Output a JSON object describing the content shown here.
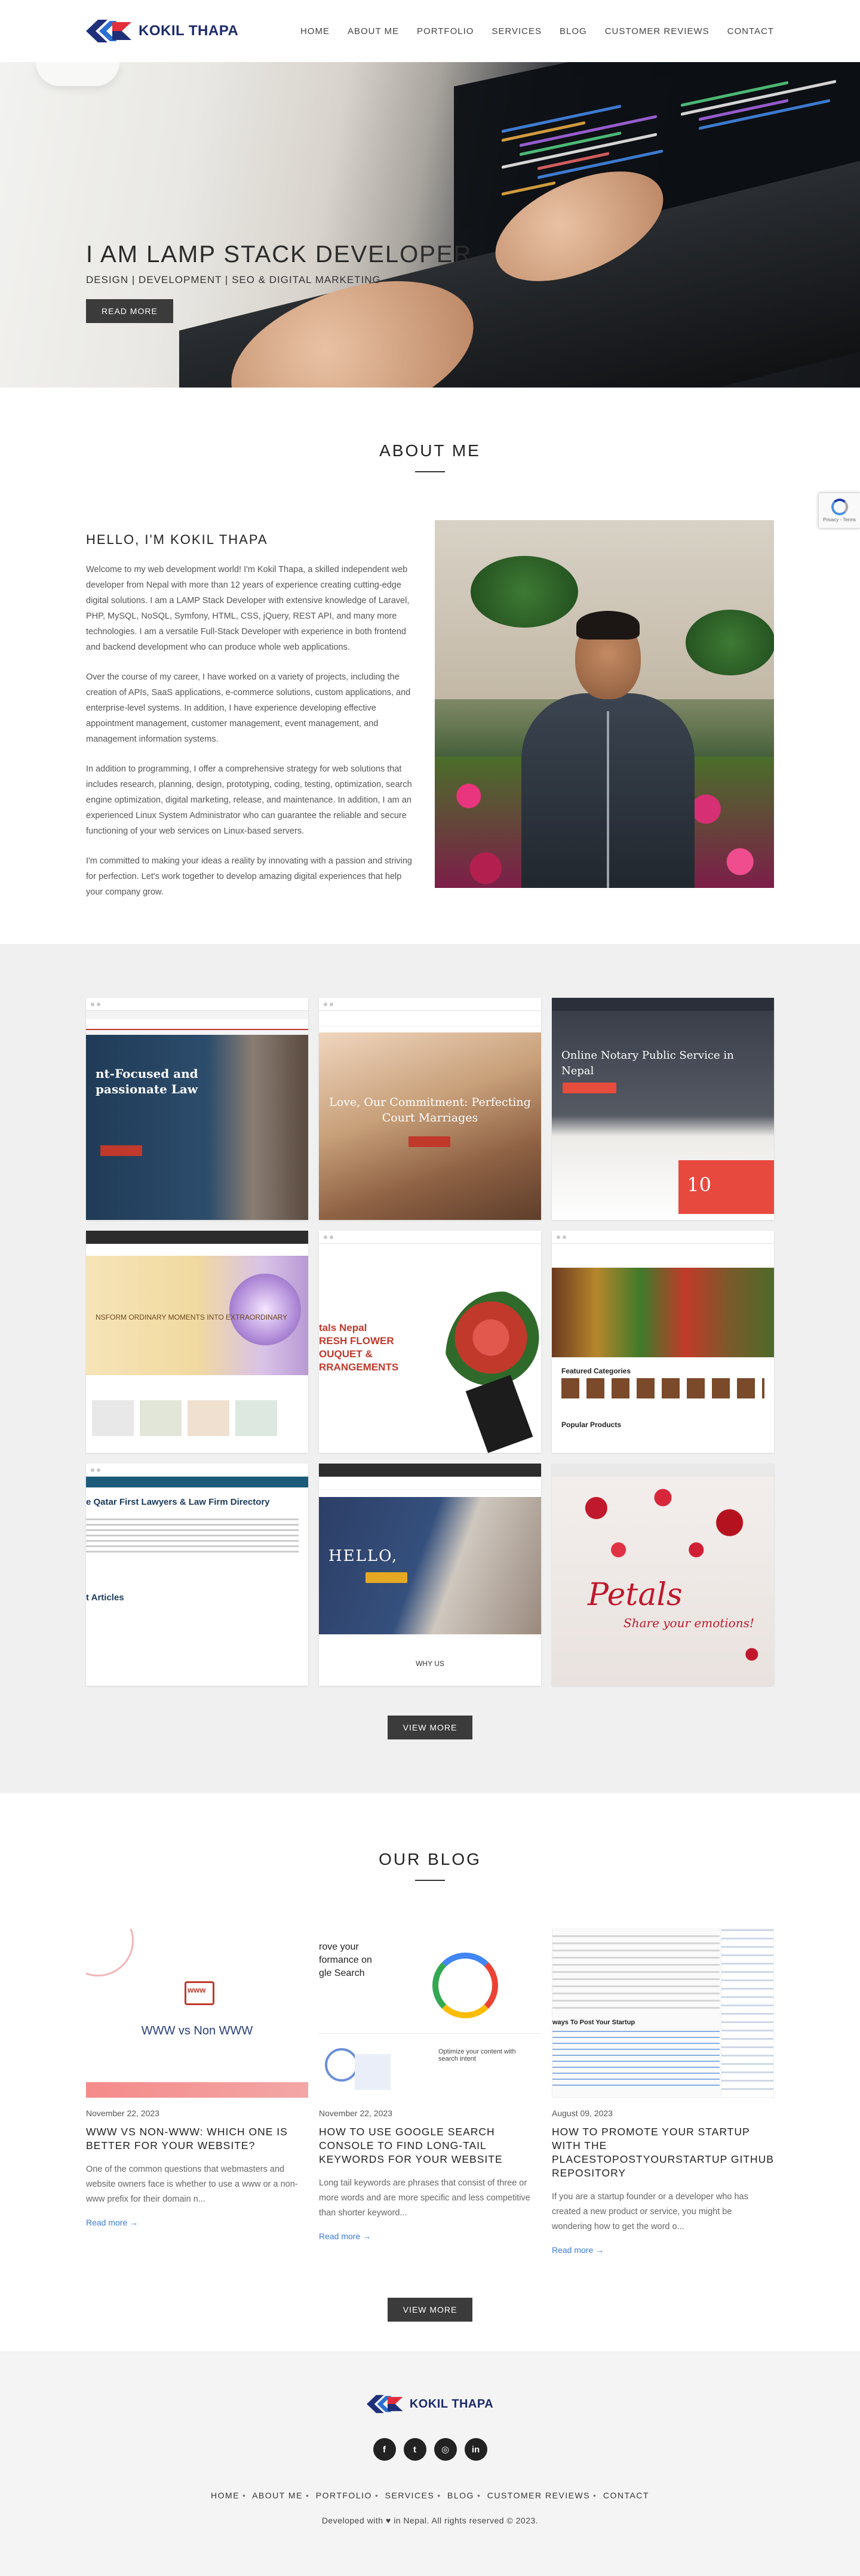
{
  "brand": {
    "name": "KOKIL THAPA"
  },
  "nav": {
    "items": [
      {
        "label": "HOME"
      },
      {
        "label": "ABOUT ME"
      },
      {
        "label": "PORTFOLIO"
      },
      {
        "label": "SERVICES"
      },
      {
        "label": "BLOG"
      },
      {
        "label": "CUSTOMER REVIEWS"
      },
      {
        "label": "CONTACT"
      }
    ]
  },
  "hero": {
    "title": "I AM LAMP STACK DEVELOPER",
    "subtitle": "DESIGN | DEVELOPMENT | SEO & DIGITAL MARKETING",
    "button": "READ MORE"
  },
  "about": {
    "section_title": "ABOUT ME",
    "heading": "HELLO, I'M KOKIL THAPA",
    "paragraphs": [
      "Welcome to my web development world! I'm Kokil Thapa, a skilled independent web developer from Nepal with more than 12 years of experience creating cutting-edge digital solutions. I am a LAMP Stack Developer with extensive knowledge of Laravel, PHP, MySQL, NoSQL, Symfony, HTML, CSS, jQuery, REST API, and many more technologies. I am a versatile Full-Stack Developer with experience in both frontend and backend development who can produce whole web applications.",
      "Over the course of my career, I have worked on a variety of projects, including the creation of APIs, SaaS applications, e-commerce solutions, custom applications, and enterprise-level systems. In addition, I have experience developing effective appointment management, customer management, event management, and management information systems.",
      "In addition to programming, I offer a comprehensive strategy for web solutions that includes research, planning, design, prototyping, coding, testing, optimization, search engine optimization, digital marketing, release, and maintenance. In addition, I am an experienced Linux System Administrator who can guarantee the reliable and secure functioning of your web services on Linux-based servers.",
      "I'm committed to making your ideas a reality by innovating with a passion and striving for perfection. Let's work together to develop amazing digital experiences that help your company grow."
    ]
  },
  "recaptcha": {
    "text": "Privacy - Terms"
  },
  "portfolio": {
    "items": [
      {
        "title": "nt-Focused and\npassionate Law",
        "accent": "#1f3b57"
      },
      {
        "title": "Love, Our Commitment: Perfecting Court Marriages",
        "accent": "#c8a07a"
      },
      {
        "title": "Online Notary Public Service in Nepal",
        "accent": "#2a2f3a",
        "badge": "10"
      },
      {
        "title": "NSFORM ORDINARY MOMENTS INTO EXTRAORDINARY",
        "accent": "#f1d9a0"
      },
      {
        "title": "tals Nepal\nRESH FLOWER\nOUQUET &\nRRANGEMENTS",
        "accent": "#c0392b"
      },
      {
        "title": "Featured Categories",
        "title2": "Popular Products",
        "accent": "#8e7b55"
      },
      {
        "title": "e Qatar First Lawyers & Law Firm Directory",
        "title2": "t Articles",
        "accent": "#1c5a7a"
      },
      {
        "title": "HELLO,",
        "title2": "WHY US",
        "accent": "#2c3e66"
      },
      {
        "title": "Petals",
        "title2": "Share your emotions!",
        "accent": "#c0182c"
      }
    ],
    "button": "VIEW MORE"
  },
  "blog": {
    "section_title": "OUR BLOG",
    "posts": [
      {
        "image_text": "WWW vs Non WWW",
        "image_badge": "www",
        "date": "November 22, 2023",
        "title": "WWW VS NON-WWW: WHICH ONE IS BETTER FOR YOUR WEBSITE?",
        "excerpt": "One of the common questions that webmasters and website owners face is whether to use a www or a non-www prefix for their domain n...",
        "link": "Read more →"
      },
      {
        "image_text": "rove your\nformance on\ngle Search",
        "image_text2": "Optimize your content with search intent",
        "date": "November 22, 2023",
        "title": "HOW TO USE GOOGLE SEARCH CONSOLE TO FIND LONG-TAIL KEYWORDS FOR YOUR WEBSITE",
        "excerpt": "Long tail keywords are phrases that consist of three or more words and are more specific and less competitive than shorter keyword...",
        "link": "Read more →"
      },
      {
        "image_text": "ways To Post Your Startup",
        "date": "August 09, 2023",
        "title": "HOW TO PROMOTE YOUR STARTUP WITH THE PLACESTOPOSTYOURSTARTUP GITHUB REPOSITORY",
        "excerpt": "If you are a startup founder or a developer who has created a new product or service, you might be wondering how to get the word o...",
        "link": "Read more →"
      }
    ],
    "button": "VIEW MORE"
  },
  "footer": {
    "socials": [
      {
        "name": "facebook-icon",
        "glyph": "f"
      },
      {
        "name": "twitter-icon",
        "glyph": "t"
      },
      {
        "name": "instagram-icon",
        "glyph": "◎"
      },
      {
        "name": "linkedin-icon",
        "glyph": "in"
      }
    ],
    "nav": [
      "HOME",
      "ABOUT ME",
      "PORTFOLIO",
      "SERVICES",
      "BLOG",
      "CUSTOMER REVIEWS",
      "CONTACT"
    ],
    "separator": "•",
    "copyright": "Developed with ♥ in Nepal. All rights reserved © 2023."
  }
}
